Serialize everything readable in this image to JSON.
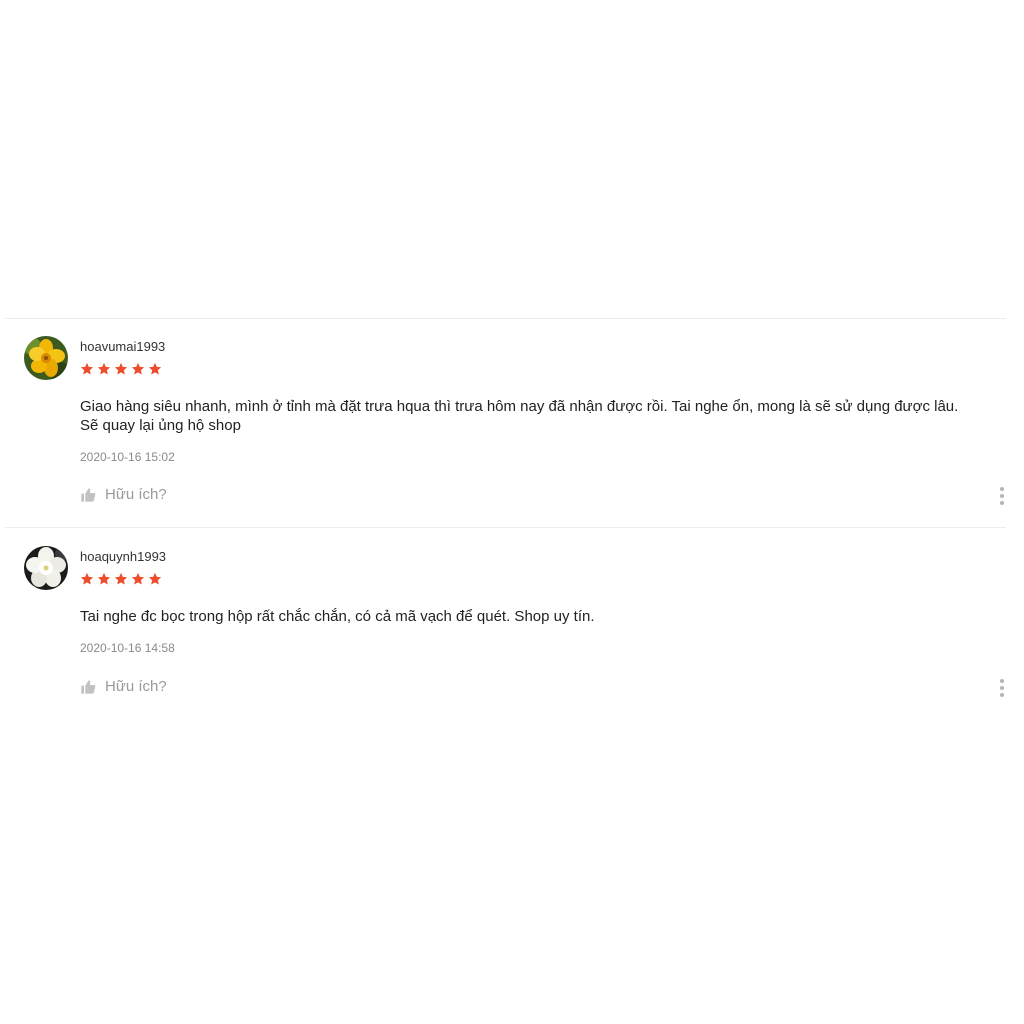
{
  "colors": {
    "star": "#ee4d2d",
    "divider": "#ececec",
    "muted_text": "#8a8a8a"
  },
  "reviews": [
    {
      "username": "hoavumai1993",
      "avatar": "yellow-flower-avatar",
      "rating": 5,
      "comment_line_1": "Giao hàng siêu nhanh, mình ở tỉnh mà đặt trưa hqua thì trưa hôm nay đã nhận được rồi. Tai nghe ổn, mong là sẽ sử dụng được lâu.",
      "comment_line_2": "Sẽ quay lại ủng hộ shop",
      "timestamp": "2020-10-16 15:02",
      "helpful_label": "Hữu ích?"
    },
    {
      "username": "hoaquynh1993",
      "avatar": "white-flower-avatar",
      "rating": 5,
      "comment_line_1": "Tai nghe đc bọc trong hộp rất chắc chắn, có cả mã vạch để quét. Shop uy tín.",
      "timestamp": "2020-10-16 14:58",
      "helpful_label": "Hữu ích?"
    }
  ]
}
